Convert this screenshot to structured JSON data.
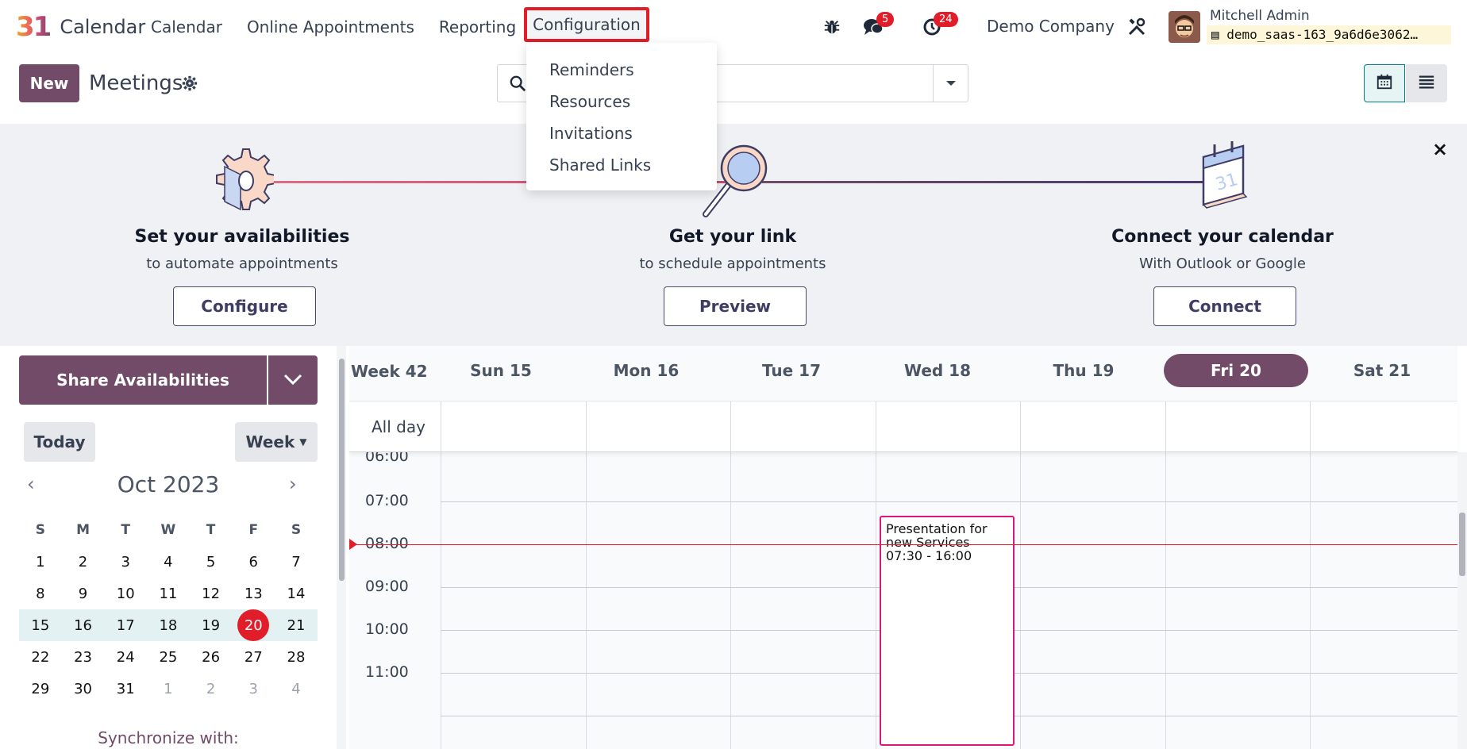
{
  "app": {
    "brand_logo": "31",
    "name": "Calendar"
  },
  "nav": {
    "items": [
      "Calendar",
      "Online Appointments",
      "Reporting"
    ],
    "active": "Configuration",
    "chat_badge": "5",
    "activity_badge": "24",
    "company": "Demo Company",
    "user_name": "Mitchell Admin",
    "database": "demo_saas-163_9a6d6e3062…"
  },
  "dropdown": {
    "items": [
      "Reminders",
      "Resources",
      "Invitations",
      "Shared Links"
    ]
  },
  "control": {
    "new_label": "New",
    "title": "Meetings"
  },
  "onboarding": {
    "steps": [
      {
        "title": "Set your availabilities",
        "subtitle": "to automate appointments",
        "button": "Configure"
      },
      {
        "title": "Get your link",
        "subtitle": "to schedule appointments",
        "button": "Preview"
      },
      {
        "title": "Connect your calendar",
        "subtitle": "With Outlook or Google",
        "button": "Connect"
      }
    ],
    "close": "×"
  },
  "sidebar": {
    "share_label": "Share Availabilities",
    "today_label": "Today",
    "week_label": "Week",
    "month_title": "Oct 2023",
    "weekday_heads": [
      "S",
      "M",
      "T",
      "W",
      "T",
      "F",
      "S"
    ],
    "weeks": [
      [
        "1",
        "2",
        "3",
        "4",
        "5",
        "6",
        "7"
      ],
      [
        "8",
        "9",
        "10",
        "11",
        "12",
        "13",
        "14"
      ],
      [
        "15",
        "16",
        "17",
        "18",
        "19",
        "20",
        "21"
      ],
      [
        "22",
        "23",
        "24",
        "25",
        "26",
        "27",
        "28"
      ],
      [
        "29",
        "30",
        "31",
        "1",
        "2",
        "3",
        "4"
      ]
    ],
    "selected_day": "20",
    "sync_label": "Synchronize with:"
  },
  "calendar": {
    "week_label": "Week 42",
    "days": [
      "Sun 15",
      "Mon 16",
      "Tue 17",
      "Wed 18",
      "Thu 19",
      "Fri 20",
      "Sat 21"
    ],
    "active_day": "Fri 20",
    "allday_label": "All day",
    "times": [
      "06:00",
      "07:00",
      "08:00",
      "09:00",
      "10:00",
      "11:00"
    ],
    "event": {
      "title": "Presentation for new Services",
      "time": "07:30 - 16:00",
      "day": "Wed 18"
    }
  },
  "colors": {
    "brand": "#714b67",
    "accent_red": "#e11d2a",
    "event_border": "#e0177b"
  },
  "icons": [
    "bug-icon",
    "chat-icon",
    "clock-icon",
    "tools-icon",
    "gear-icon",
    "search-icon",
    "calendar-view-icon",
    "list-view-icon"
  ]
}
